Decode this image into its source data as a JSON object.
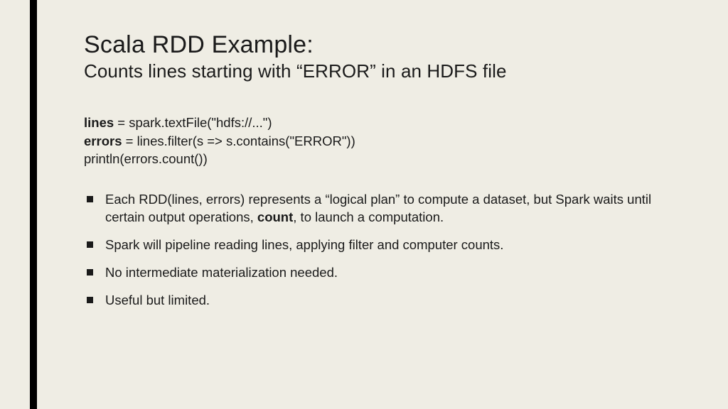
{
  "title": "Scala RDD Example:",
  "subtitle": "Counts lines starting with “ERROR” in an HDFS file",
  "code": {
    "line1_var": "lines",
    "line1_rest": " = spark.textFile(\"hdfs://...\")",
    "line2_var": "errors",
    "line2_rest": " = lines.filter(s => s.contains(\"ERROR\"))",
    "line3": "println(errors.count())"
  },
  "bullets": {
    "b1_pre": "Each RDD(lines, errors) represents a “logical plan” to compute a dataset, but Spark waits until certain output operations, ",
    "b1_bold": "count",
    "b1_post": ", to launch a computation.",
    "b2": "Spark will pipeline reading lines, applying filter and computer counts.",
    "b3": "No intermediate materialization needed.",
    "b4": "Useful but limited."
  }
}
